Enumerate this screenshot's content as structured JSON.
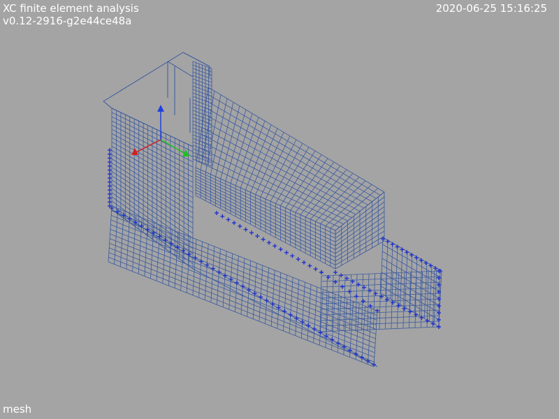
{
  "header": {
    "title": "XC finite element analysis",
    "version": "v0.12-2916-g2e44ce48a",
    "timestamp": "2020-06-25 15:16:25"
  },
  "footer": {
    "view_label": "mesh"
  },
  "colors": {
    "background": "#a4a4a4",
    "mesh": "#3a5aa0",
    "support": "#2233cc",
    "axis_x": "#d42020",
    "axis_y": "#20c020",
    "axis_z": "#2040e0",
    "text": "#ffffff"
  }
}
